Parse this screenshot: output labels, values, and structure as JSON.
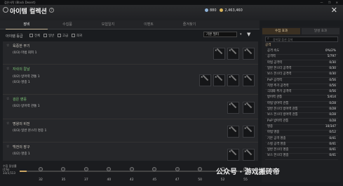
{
  "window": {
    "title": "검은사막 (Black Desert)",
    "controls": "— ❐ ✕"
  },
  "header": {
    "title": "아이템 컬렉션",
    "help": "?",
    "silver": "880",
    "gold": "2,463,460",
    "close": "✕"
  },
  "tabs": [
    {
      "label": "장비"
    },
    {
      "label": "수집품"
    },
    {
      "label": "모험일지"
    },
    {
      "label": "이벤트"
    },
    {
      "label": "즐겨찾기"
    }
  ],
  "filters": {
    "label": "아이템 등급",
    "options": [
      "전체",
      "일반",
      "고급",
      "희귀"
    ],
    "sort": "기본 필터",
    "sort_arrow": "▾",
    "filter_icon": "▼"
  },
  "items": [
    {
      "name": "육중한 무기",
      "lines": [
        "(0/3) 마법 회피 1"
      ],
      "color": "#d8d4c8"
    },
    {
      "name": "자쉬의 칼날",
      "lines": [
        "(0/2) 방어력 관통 1",
        "(0/3) 명중 1"
      ],
      "color": "#7fc97a"
    },
    {
      "name": "검은 영웅",
      "lines": [
        "(0/2) 방어력 관통 1"
      ],
      "color": "#7fc97a"
    },
    {
      "name": "명왕의 비전",
      "lines": [
        "(0/3) 일반 몬스터 명중 1"
      ],
      "color": "#d8d4c8"
    },
    {
      "name": "백전의 장구",
      "lines": [
        "(0/2) 명중 1"
      ],
      "color": "#d8d4c8"
    }
  ],
  "right_panel": {
    "tabs": [
      {
        "label": "수집 효과"
      },
      {
        "label": "달성 효과"
      }
    ],
    "search_placeholder": "장착할 옵션 검색",
    "section": "공격",
    "stats": [
      {
        "label": "공격 속도",
        "value": "0%/2%"
      },
      {
        "label": "공격력",
        "value": "5/797"
      },
      {
        "label": "마법 공격력",
        "value": "0/30"
      },
      {
        "label": "일반 몬스터 공격력",
        "value": "0/30"
      },
      {
        "label": "보스 몬스터 공격력",
        "value": "0/30"
      },
      {
        "label": "PvP 공격력",
        "value": "0/56"
      },
      {
        "label": "치명 추가 공격력",
        "value": "0/56"
      },
      {
        "label": "극대화 추가 공격력",
        "value": "0/56"
      },
      {
        "label": "방어력 관통",
        "value": "5/414"
      },
      {
        "label": "마법 방어력 관통",
        "value": "0/28"
      },
      {
        "label": "일반 몬스터 방어력 관통",
        "value": "0/28"
      },
      {
        "label": "보스 몬스터 방어력 관통",
        "value": "0/28"
      },
      {
        "label": "PvP 방어력 관통",
        "value": "0/28"
      },
      {
        "label": "명중",
        "value": "10/347"
      },
      {
        "label": "마법 명중",
        "value": "0/12"
      },
      {
        "label": "기본 공격 명중",
        "value": "0/41"
      },
      {
        "label": "스킬 공격 명중",
        "value": "0/41"
      },
      {
        "label": "일반 몬스터 명중",
        "value": "0/41"
      },
      {
        "label": "보스 몬스터 명중",
        "value": "0/41"
      }
    ]
  },
  "bottom": {
    "collect_label": "수집 달성률",
    "collect_pct": "(1%)",
    "collect_count": "33/3,513",
    "progress": 0.03,
    "milestones": [
      "32",
      "35",
      "37",
      "40",
      "42",
      "45",
      "47",
      "50",
      "52",
      "55"
    ],
    "watermark": "公众号 · 游戏搬砖帝"
  },
  "colors": {
    "accent": "#c9a563",
    "green": "#7fc97a",
    "gold_text": "#d6b98c"
  }
}
